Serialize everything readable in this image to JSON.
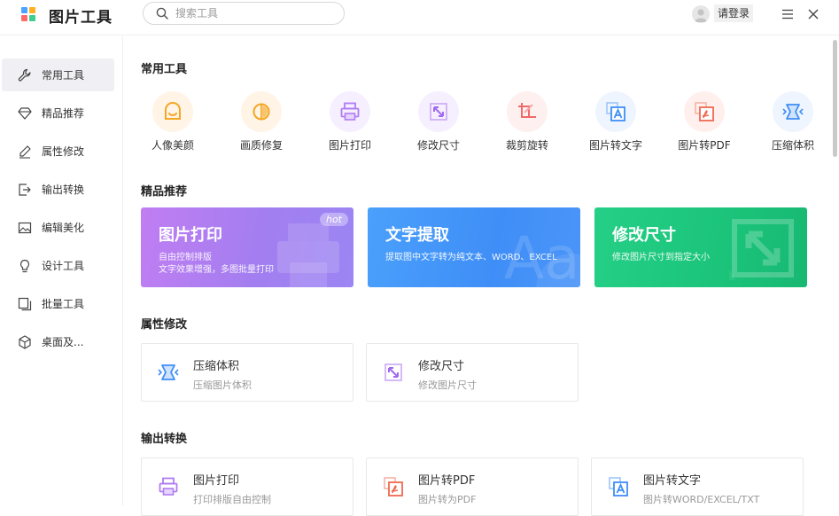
{
  "app": {
    "title": "图片工具"
  },
  "search": {
    "placeholder": "搜索工具"
  },
  "account": {
    "login_label": "请登录"
  },
  "colors": {
    "accent": "#5b5bd6",
    "print": "#a57bf0",
    "text": "#3f8ef7",
    "resize": "#1bc47a"
  },
  "sidebar": {
    "items": [
      {
        "label": "常用工具",
        "icon": "wrench-icon",
        "active": true
      },
      {
        "label": "精品推荐",
        "icon": "diamond-icon"
      },
      {
        "label": "属性修改",
        "icon": "pencil-icon"
      },
      {
        "label": "输出转换",
        "icon": "export-icon"
      },
      {
        "label": "编辑美化",
        "icon": "image-edit-icon"
      },
      {
        "label": "设计工具",
        "icon": "bulb-icon"
      },
      {
        "label": "批量工具",
        "icon": "layers-icon"
      },
      {
        "label": "桌面及...",
        "icon": "cube-icon"
      }
    ]
  },
  "sections": {
    "common": {
      "title": "常用工具",
      "tools": [
        {
          "label": "人像美颜",
          "icon": "face-beauty-icon"
        },
        {
          "label": "画质修复",
          "icon": "quality-repair-icon"
        },
        {
          "label": "图片打印",
          "icon": "printer-icon"
        },
        {
          "label": "修改尺寸",
          "icon": "resize-icon"
        },
        {
          "label": "裁剪旋转",
          "icon": "crop-rotate-icon"
        },
        {
          "label": "图片转文字",
          "icon": "image-to-text-icon"
        },
        {
          "label": "图片转PDF",
          "icon": "image-to-pdf-icon"
        },
        {
          "label": "压缩体积",
          "icon": "compress-icon"
        }
      ]
    },
    "featured": {
      "title": "精品推荐",
      "banners": [
        {
          "title": "图片打印",
          "line1": "自由控制排版",
          "line2": "文字效果增强，多图批量打印",
          "badge": "hot"
        },
        {
          "title": "文字提取",
          "line1": "提取图中文字转为纯文本、WORD、EXCEL",
          "line2": ""
        },
        {
          "title": "修改尺寸",
          "line1": "修改图片尺寸到指定大小",
          "line2": ""
        }
      ]
    },
    "attributes": {
      "title": "属性修改",
      "cards": [
        {
          "title": "压缩体积",
          "subtitle": "压缩图片体积",
          "icon": "compress-icon"
        },
        {
          "title": "修改尺寸",
          "subtitle": "修改图片尺寸",
          "icon": "resize-icon"
        }
      ]
    },
    "output": {
      "title": "输出转换",
      "cards": [
        {
          "title": "图片打印",
          "subtitle": "打印排版自由控制",
          "icon": "printer-icon"
        },
        {
          "title": "图片转PDF",
          "subtitle": "图片转为PDF",
          "icon": "image-to-pdf-icon"
        },
        {
          "title": "图片转文字",
          "subtitle": "图片转WORD/EXCEL/TXT",
          "icon": "image-to-text-icon"
        }
      ]
    }
  }
}
